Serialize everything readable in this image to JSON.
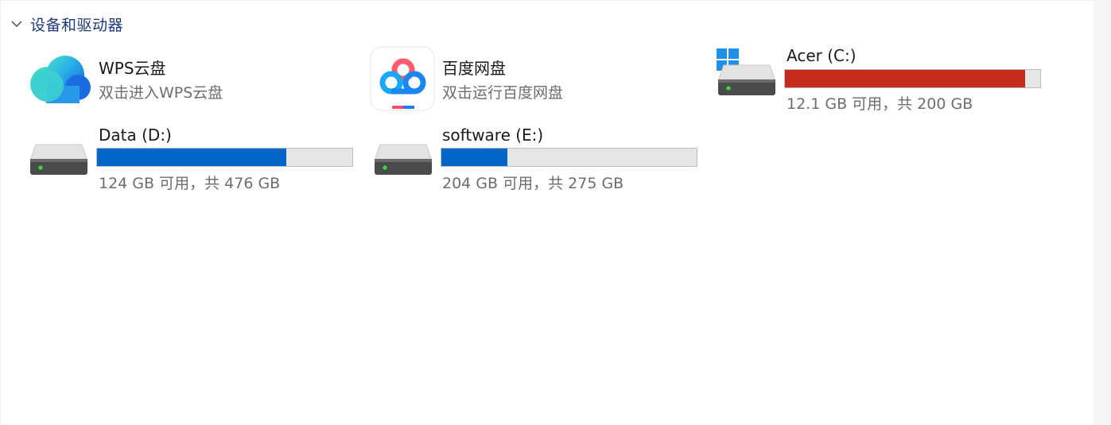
{
  "section": {
    "title": "设备和驱动器"
  },
  "items": {
    "wps": {
      "name": "WPS云盘",
      "subtitle": "双击进入WPS云盘"
    },
    "baidu": {
      "name": "百度网盘",
      "subtitle": "双击运行百度网盘"
    },
    "drive_c": {
      "name": "Acer (C:)",
      "capacity_text": "12.1 GB 可用，共 200 GB",
      "used_fraction": 0.94,
      "bar_color": "#c42b1c"
    },
    "drive_d": {
      "name": "Data (D:)",
      "capacity_text": "124 GB 可用，共 476 GB",
      "used_fraction": 0.74,
      "bar_color": "#0066c8"
    },
    "drive_e": {
      "name": "software (E:)",
      "capacity_text": "204 GB 可用，共 275 GB",
      "used_fraction": 0.26,
      "bar_color": "#0066c8"
    }
  },
  "colors": {
    "header": "#1e3a78",
    "bar_track": "#e6e6e6",
    "bar_blue": "#0066c8",
    "bar_red": "#c42b1c"
  }
}
